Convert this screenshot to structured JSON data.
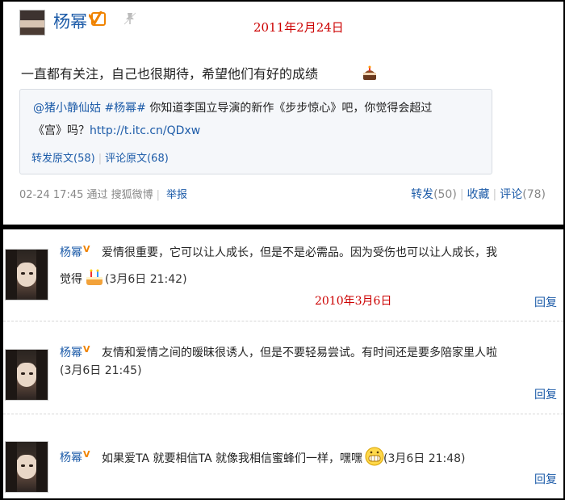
{
  "top_post": {
    "author": "杨幂",
    "date_annotation": "2011年2月24日",
    "text": "一直都有关注，自己也很期待，希望他们有好的成绩",
    "quote": {
      "mention": "@猪小静仙姑",
      "hashtag": "#杨幂#",
      "text_1": " 你知道李国立导演的新作《步步惊心》吧，你觉得会超过",
      "text_2": "《宫》吗？",
      "link": "http://t.itc.cn/QDxw",
      "repost_label": "转发原文",
      "repost_count": "(58)",
      "comment_label": "评论原文",
      "comment_count": "(68)"
    },
    "meta": {
      "timestamp": "02-24 17:45",
      "via": "通过 搜狐微博",
      "report": "举报",
      "repost_label": "转发",
      "repost_count": "(50)",
      "favorite_label": "收藏",
      "comment_label": "评论",
      "comment_count": "(78)"
    }
  },
  "date_annotation_bottom": "2010年3月6日",
  "comments": [
    {
      "author": "杨幂",
      "text_line1": "爱情很重要，它可以让人成长，但是不是必需品。因为受伤也可以让人成长，我",
      "text_line2": "觉得",
      "time": "(3月6日  21:42)",
      "reply": "回复"
    },
    {
      "author": "杨幂",
      "text_line1": "友情和爱情之间的暧昧很诱人，但是不要轻易尝试。有时间还是要多陪家里人啦",
      "time": "(3月6日  21:45)",
      "reply": "回复"
    },
    {
      "author": "杨幂",
      "text_line1": "如果爱TA 就要相信TA 就像我相信蜜蜂们一样，嘿嘿",
      "time": "(3月6日  21:48)",
      "reply": "回复"
    }
  ],
  "icons": {
    "verified": "verified-v-icon",
    "pin": "pin-icon",
    "cake": "cake-icon",
    "smile": "grin-emoji-icon"
  },
  "colors": {
    "link_blue": "#1c5ba8",
    "annotation_red": "#cc0000",
    "verified_orange": "#f08300"
  }
}
